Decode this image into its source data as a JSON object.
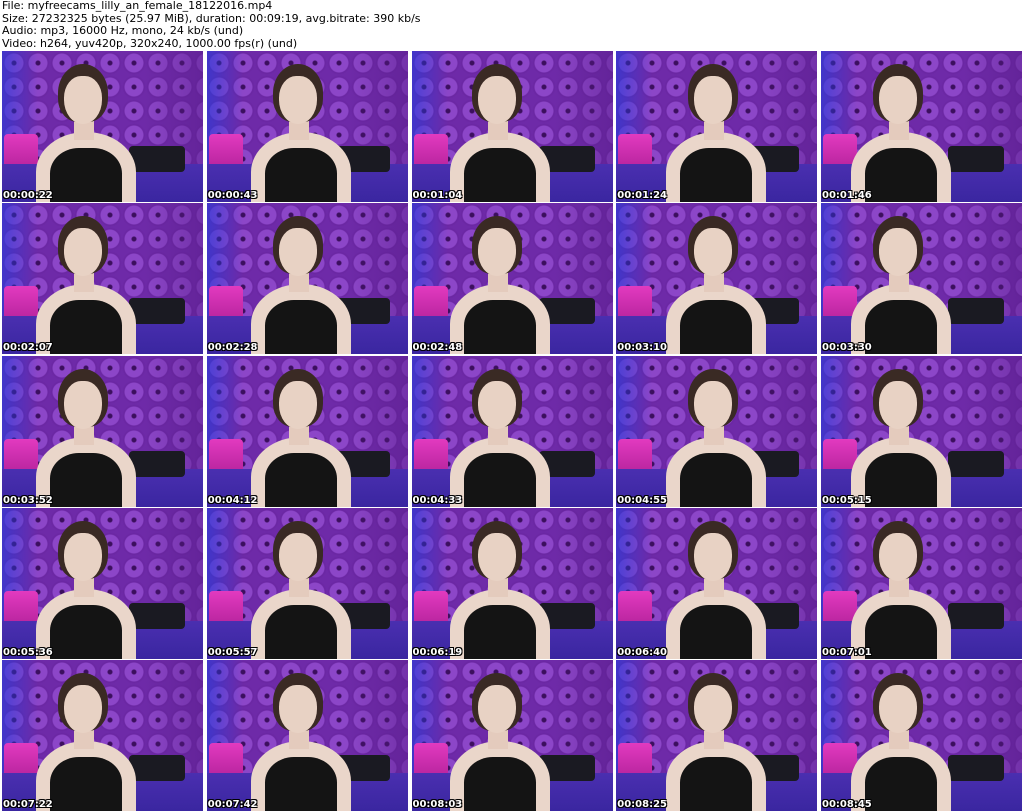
{
  "header": {
    "file_line": "File: myfreecams_lilly_an_female_18122016.mp4",
    "size_line": "Size: 27232325 bytes (25.97 MiB), duration: 00:09:19, avg.bitrate: 390 kb/s",
    "audio_line": "Audio: mp3, 16000 Hz, mono, 24 kb/s (und)",
    "video_line": "Video: h264, yuv420p, 320x240, 1000.00 fps(r) (und)"
  },
  "thumbnails": [
    {
      "timestamp": "00:00:22"
    },
    {
      "timestamp": "00:00:43"
    },
    {
      "timestamp": "00:01:04"
    },
    {
      "timestamp": "00:01:24"
    },
    {
      "timestamp": "00:01:46"
    },
    {
      "timestamp": "00:02:07"
    },
    {
      "timestamp": "00:02:28"
    },
    {
      "timestamp": "00:02:48"
    },
    {
      "timestamp": "00:03:10"
    },
    {
      "timestamp": "00:03:30"
    },
    {
      "timestamp": "00:03:52"
    },
    {
      "timestamp": "00:04:12"
    },
    {
      "timestamp": "00:04:33"
    },
    {
      "timestamp": "00:04:55"
    },
    {
      "timestamp": "00:05:15"
    },
    {
      "timestamp": "00:05:36"
    },
    {
      "timestamp": "00:05:57"
    },
    {
      "timestamp": "00:06:19"
    },
    {
      "timestamp": "00:06:40"
    },
    {
      "timestamp": "00:07:01"
    },
    {
      "timestamp": "00:07:22"
    },
    {
      "timestamp": "00:07:42"
    },
    {
      "timestamp": "00:08:03"
    },
    {
      "timestamp": "00:08:25"
    },
    {
      "timestamp": "00:08:45"
    }
  ],
  "colors": {
    "background": "#ffffff",
    "header_text": "#000000",
    "timestamp_text": "#ffffff",
    "wall_purple": "#6e2aa8"
  }
}
